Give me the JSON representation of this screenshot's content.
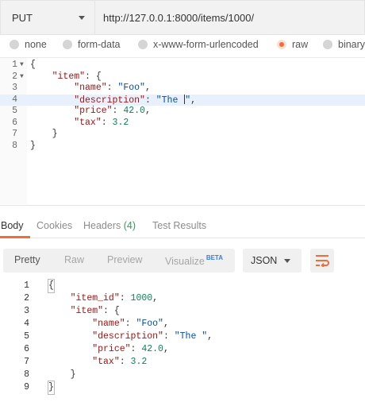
{
  "request": {
    "method": "PUT",
    "url": "http://127.0.0.1:8000/items/1000/"
  },
  "body_types": [
    "none",
    "form-data",
    "x-www-form-urlencoded",
    "raw",
    "binary"
  ],
  "body_type_selected": "raw",
  "editor": {
    "line_numbers": [
      "1",
      "2",
      "3",
      "4",
      "5",
      "6",
      "7",
      "8"
    ],
    "active_line": 4,
    "lines": {
      "l1": "{",
      "l2_key": "\"item\"",
      "l2_rest": ": {",
      "l3_key": "\"name\"",
      "l3_val": "\"Foo\"",
      "l4_key": "\"description\"",
      "l4_val_a": "\"The ",
      "l4_val_b": "\"",
      "l5_key": "\"price\"",
      "l5_val": "42.0",
      "l6_key": "\"tax\"",
      "l6_val": "3.2",
      "l7": "}",
      "l8": "}"
    }
  },
  "response_tabs": {
    "body": "Body",
    "cookies": "Cookies",
    "headers": "Headers",
    "headers_count": "(4)",
    "test_results": "Test Results"
  },
  "view_modes": {
    "pretty": "Pretty",
    "raw": "Raw",
    "preview": "Preview",
    "visualize": "Visualize",
    "visualize_badge": "BETA"
  },
  "format": "JSON",
  "icons": {
    "format_dropdown": "chevron-down-icon",
    "wrap": "wrap-lines-icon"
  },
  "response": {
    "line_numbers": [
      "1",
      "2",
      "3",
      "4",
      "5",
      "6",
      "7",
      "8",
      "9"
    ],
    "lines": {
      "l1": "{",
      "l2_key": "\"item_id\"",
      "l2_val": "1000",
      "l3_key": "\"item\"",
      "l3_rest": ": {",
      "l4_key": "\"name\"",
      "l4_val": "\"Foo\"",
      "l5_key": "\"description\"",
      "l5_val": "\"The \"",
      "l6_key": "\"price\"",
      "l6_val": "42.0",
      "l7_key": "\"tax\"",
      "l7_val": "3.2",
      "l8": "}",
      "l9": "}"
    }
  },
  "colors": {
    "accent": "#f26b3a",
    "count_green": "#2e9f5b",
    "beta_blue": "#3d7dd8"
  }
}
